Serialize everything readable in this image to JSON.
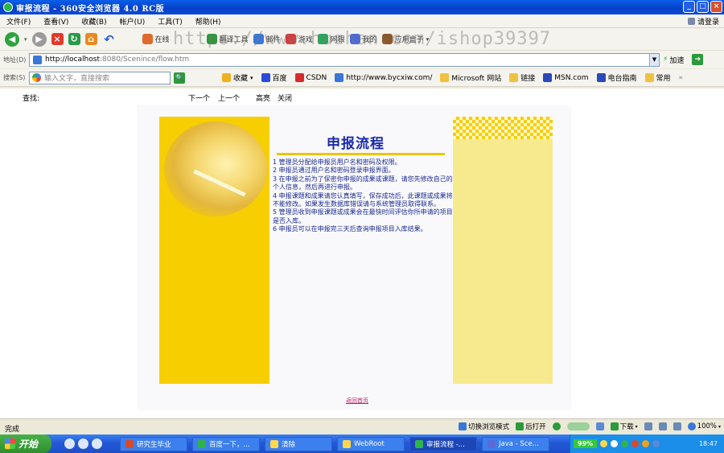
{
  "window": {
    "title": "审报流程 - 360安全浏览器 4.0 RC版",
    "buttons": [
      "_",
      "□",
      "×"
    ]
  },
  "menubar": {
    "items": [
      "文件(F)",
      "查看(V)",
      "收藏(B)",
      "帐户(U)",
      "工具(T)",
      "帮助(H)"
    ],
    "login": "请登录"
  },
  "toolbar": {
    "items": [
      "在线",
      "翻译工具",
      "邮件",
      "游戏",
      "网银",
      "我的",
      "应用盒子"
    ],
    "apps": "应用盒子"
  },
  "watermark": "https://www.huzhan.com/ishop39397",
  "address": {
    "label": "地址(D)",
    "host": "http://localhost",
    "path": ":8080/Scenince/flow.htm",
    "accelerate": "加速"
  },
  "searchbar": {
    "label": "搜索(S)",
    "placeholder": "输入文字，直接搜索"
  },
  "favorites": [
    "收藏",
    "百度",
    "CSDN",
    "http://www.bycxiw.com/",
    "Microsoft 网站",
    "链接",
    "MSN.com",
    "电台指南",
    "常用"
  ],
  "findbar": {
    "label": "查找:",
    "next": "下一个",
    "prev": "上一个",
    "highlight": "高亮",
    "close": "关闭"
  },
  "page": {
    "heading": "申报流程",
    "steps": [
      "1  管理员分配给申报员用户名和密码及权限。",
      "2  申报员通过用户名和密码登录申报界面。",
      "3  在申报之前为了保密你申报的成果或课题，请您先修改自己的个人信息，然后再进行申报。",
      "4  申报课题和成果请您认真填写，保存成功后，此课题或成果将不能修改。如果发生数据库错误请与系统管理员取得联系。",
      "5  管理员收到申报课题或成果会在最快时间评估你所申请的项目是否入库。",
      "6  申报员可以在申报完三天后查询申报项目入库结果。"
    ],
    "back_link": "返回首页"
  },
  "statusbar": {
    "status": "完成",
    "switch_mode": "切换浏览模式",
    "reopen": "后打开",
    "downloads": "下载",
    "zoom": "100%"
  },
  "taskbar": {
    "start": "开始",
    "tasks": [
      "研究生毕业",
      "百度一下，...",
      "清除",
      "WebRoot",
      "审报流程 -...",
      "Java - Sce..."
    ],
    "battery": "99%",
    "clock": "18:47"
  }
}
